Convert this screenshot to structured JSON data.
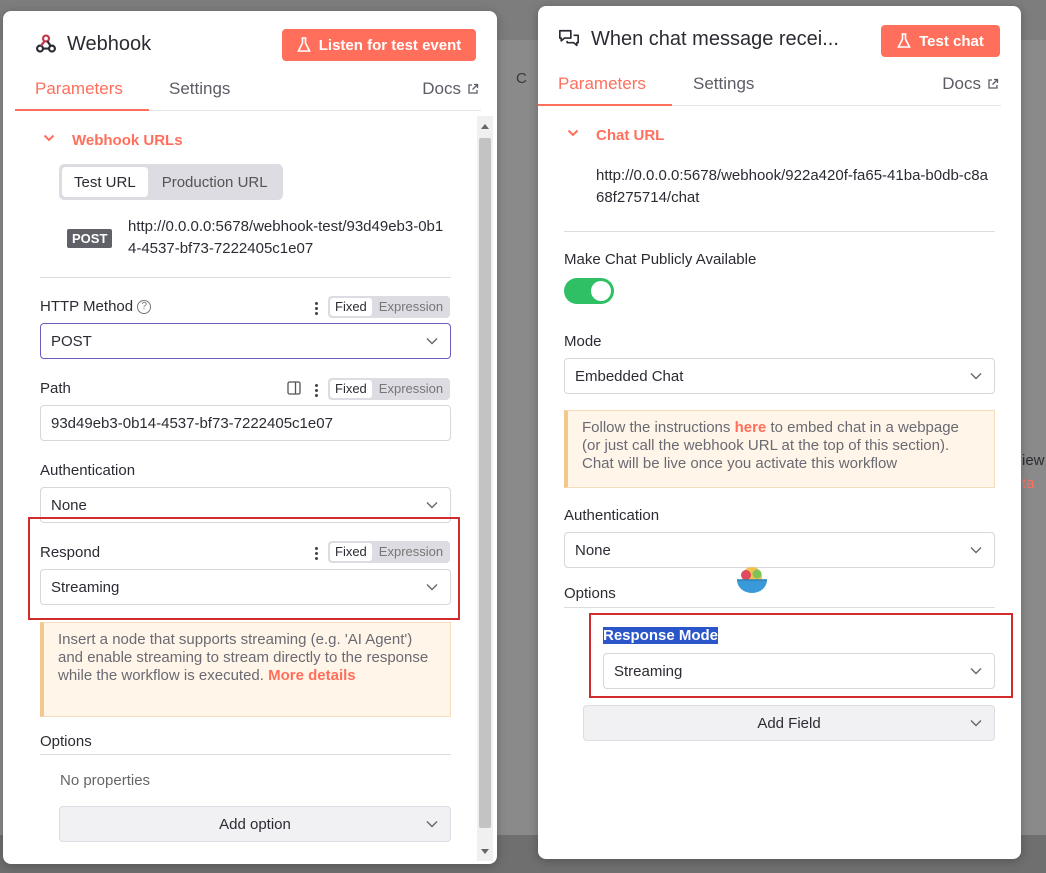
{
  "background": {
    "frag_c": "C",
    "frag_view": "iew",
    "frag_ta": "ta"
  },
  "webhook_panel": {
    "title": "Webhook",
    "listen_button": "Listen for test event",
    "tabs": [
      "Parameters",
      "Settings"
    ],
    "docs": "Docs",
    "urls_section": "Webhook URLs",
    "url_tabs": [
      "Test URL",
      "Production URL"
    ],
    "method_badge": "POST",
    "url": "http://0.0.0.0:5678/webhook-test/93d49eb3-0b14-4537-bf73-7222405c1e07",
    "http_method_label": "HTTP Method",
    "http_method_value": "POST",
    "path_label": "Path",
    "path_value": "93d49eb3-0b14-4537-bf73-7222405c1e07",
    "auth_label": "Authentication",
    "auth_value": "None",
    "respond_label": "Respond",
    "respond_value": "Streaming",
    "fixed": "Fixed",
    "expression": "Expression",
    "notice_text": "Insert a node that supports streaming (e.g. 'AI Agent') and enable streaming to stream directly to the response while the workflow is executed.",
    "notice_link": "More details",
    "options_label": "Options",
    "no_properties": "No properties",
    "add_option": "Add option"
  },
  "chat_panel": {
    "title": "When chat message recei...",
    "test_button": "Test chat",
    "tabs": [
      "Parameters",
      "Settings"
    ],
    "docs": "Docs",
    "chat_url_section": "Chat URL",
    "chat_url": "http://0.0.0.0:5678/webhook/922a420f-fa65-41ba-b0db-c8a68f275714/chat",
    "public_label": "Make Chat Publicly Available",
    "public_enabled": true,
    "mode_label": "Mode",
    "mode_value": "Embedded Chat",
    "notice_pre": "Follow the instructions",
    "notice_link": "here",
    "notice_post": "to embed chat in a webpage (or just call the webhook URL at the top of this section). Chat will be live once you activate this workflow",
    "auth_label": "Authentication",
    "auth_value": "None",
    "options_label": "Options",
    "response_mode_label": "Response Mode",
    "response_mode_value": "Streaming",
    "add_field": "Add Field"
  },
  "colors": {
    "accent": "#ff6f5c",
    "toggle_on": "#2fc065",
    "annotation": "#d12b2b",
    "selection": "#2a56c9"
  }
}
